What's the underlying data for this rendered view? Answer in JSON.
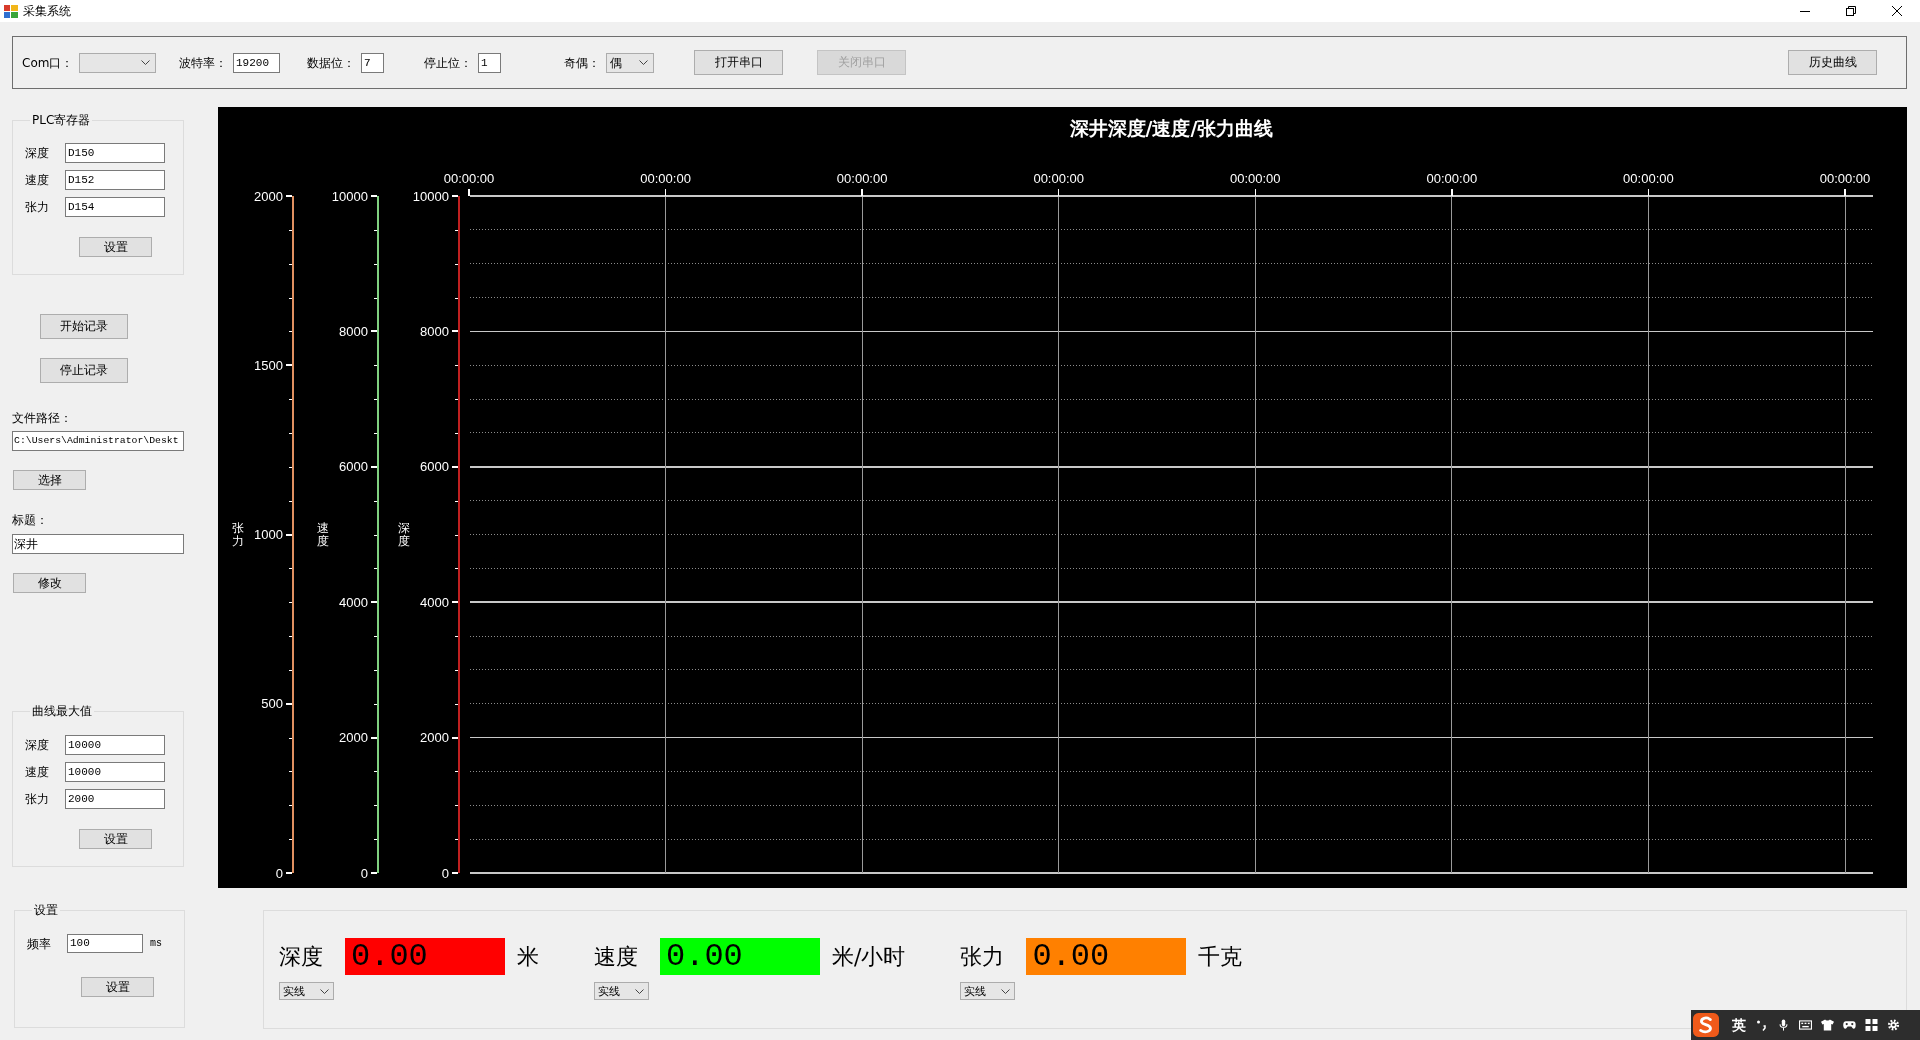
{
  "window": {
    "title": "采集系统"
  },
  "serial_settings": [
    {
      "kind": "combo",
      "label": "Com口："
    },
    {
      "kind": "text",
      "label": "波特率：",
      "value": "19200"
    },
    {
      "kind": "text",
      "label": "数据位：",
      "value": "7"
    },
    {
      "kind": "text",
      "label": "停止位：",
      "value": "1"
    },
    {
      "kind": "combo",
      "label": "奇偶：",
      "value": "偶"
    }
  ],
  "serial_buttons": [
    {
      "label": "打开串口",
      "disabled": false
    },
    {
      "label": "关闭串口",
      "disabled": true
    }
  ],
  "history_button": {
    "label": "历史曲线"
  },
  "plc_registers": {
    "title": "PLC寄存器",
    "fields": [
      {
        "label": "深度",
        "value": "D150"
      },
      {
        "label": "速度",
        "value": "D152"
      },
      {
        "label": "张力",
        "value": "D154"
      }
    ],
    "button": "设置"
  },
  "record_buttons": [
    {
      "label": "开始记录"
    },
    {
      "label": "停止记录"
    }
  ],
  "file_path": {
    "label": "文件路径：",
    "value": "C:\\Users\\Administrator\\Deskt",
    "button": "选择"
  },
  "title_setting": {
    "label": "标题：",
    "value": "深井",
    "button": "修改"
  },
  "curve_max": {
    "title": "曲线最大值",
    "fields": [
      {
        "label": "深度",
        "value": "10000"
      },
      {
        "label": "速度",
        "value": "10000"
      },
      {
        "label": "张力",
        "value": "2000"
      }
    ],
    "button": "设置"
  },
  "settings": {
    "title": "设置",
    "fields": [
      {
        "label": "频率",
        "value": "100",
        "unit": "ms"
      }
    ],
    "button": "设置"
  },
  "chart": {
    "title": "深井深度/速度/张力曲线",
    "time_labels": [
      "00:00:00",
      "00:00:00",
      "00:00:00",
      "00:00:00",
      "00:00:00",
      "00:00:00",
      "00:00:00",
      "00:00:00"
    ],
    "axes": [
      {
        "label": "张力",
        "color": "#e09060",
        "ticks": [
          "2000",
          "1500",
          "1000",
          "500",
          "0"
        ]
      },
      {
        "label": "速度",
        "color": "#80d080",
        "ticks": [
          "10000",
          "8000",
          "6000",
          "4000",
          "2000",
          "0"
        ]
      },
      {
        "label": "深度",
        "color": "#c02020",
        "ticks": [
          "10000",
          "8000",
          "6000",
          "4000",
          "2000",
          "0"
        ]
      }
    ]
  },
  "readouts": [
    {
      "label": "深度",
      "value": "0.00",
      "unit": "米",
      "color": "#ff0000",
      "line_style": "实线"
    },
    {
      "label": "速度",
      "value": "0.00",
      "unit": "米/小时",
      "color": "#00ff00",
      "line_style": "实线"
    },
    {
      "label": "张力",
      "value": "0.00",
      "unit": "千克",
      "color": "#ff8000",
      "line_style": "实线"
    }
  ],
  "ime_toolbar": {
    "mode": "英"
  }
}
